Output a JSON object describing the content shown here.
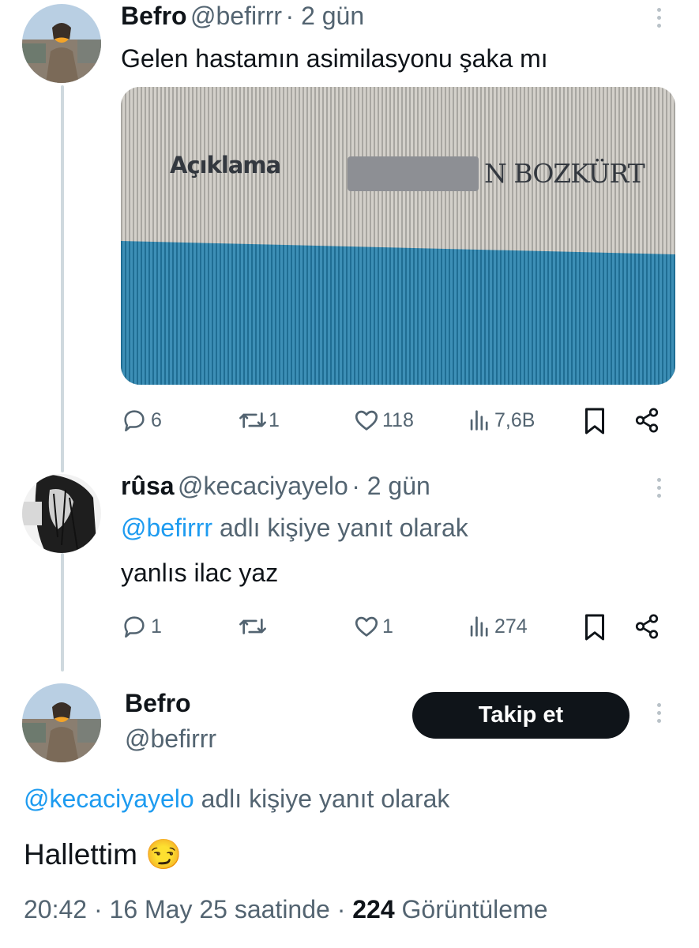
{
  "tweet1": {
    "name": "Befro",
    "handle": "@befirrr",
    "time": "· 2 gün",
    "text": "Gelen hastamın asimilasyonu şaka mı",
    "image": {
      "label_left": "Açıklama",
      "label_right": "N BOZKÜRT"
    },
    "actions": {
      "replies": "6",
      "retweets": "1",
      "likes": "118",
      "views": "7,6B"
    }
  },
  "tweet2": {
    "name": "rûsa",
    "handle": "@kecaciyayelo",
    "time": "· 2 gün",
    "reply_to_handle": "@befirrr",
    "reply_to_suffix": "adlı kişiye yanıt olarak",
    "text": "yanlıs ilac yaz",
    "actions": {
      "replies": "1",
      "retweets": "",
      "likes": "1",
      "views": "274"
    }
  },
  "main": {
    "name": "Befro",
    "handle": "@befirrr",
    "follow_label": "Takip et",
    "reply_to_handle": "@kecaciyayelo",
    "reply_to_suffix": "adlı kişiye yanıt olarak",
    "text": "Hallettim",
    "emoji": "😏",
    "timestamp": "20:42 · 16 May 25 saatinde ·",
    "views_count": "224",
    "views_label": "Görüntüleme"
  },
  "icons": [
    "reply-icon",
    "retweet-icon",
    "like-icon",
    "views-icon",
    "bookmark-icon",
    "share-icon",
    "more-icon"
  ],
  "colors": {
    "link": "#1d9bf0",
    "muted": "#536471",
    "text": "#0f1419",
    "follow_bg": "#0f1419",
    "card_blue": "#2f7fa6"
  }
}
